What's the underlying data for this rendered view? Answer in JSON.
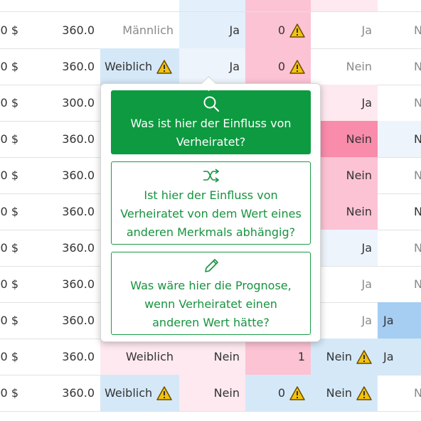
{
  "colors": {
    "accent_green": "#0e9a40",
    "pink_light": "#fde9ef",
    "pink": "#fbc3d4",
    "pink_strong": "#f98bab",
    "blue_light": "#eef4fc",
    "blue": "#d5e8f8",
    "blue_strong": "#a6cdf2",
    "warning": "#f4c20d"
  },
  "table": {
    "rows": [
      {
        "c0": "0 $",
        "c1": "360.0",
        "c2": "Männlich",
        "c3": "Ja",
        "c4": "0",
        "c5": "Ja",
        "c6": "N"
      },
      {
        "c0": "0 $",
        "c1": "360.0",
        "c2": "Weiblich",
        "c3": "Ja",
        "c4": "0",
        "c5": "Nein",
        "c6": "N"
      },
      {
        "c0": "0 $",
        "c1": "300.0",
        "c2": "",
        "c3": "",
        "c4": "",
        "c5": "Ja",
        "c6": "N"
      },
      {
        "c0": "0 $",
        "c1": "360.0",
        "c2": "",
        "c3": "",
        "c4": "",
        "c5": "Nein",
        "c6": "N"
      },
      {
        "c0": "0 $",
        "c1": "360.0",
        "c2": "",
        "c3": "",
        "c4": "",
        "c5": "Nein",
        "c6": "N"
      },
      {
        "c0": "0 $",
        "c1": "360.0",
        "c2": "",
        "c3": "",
        "c4": "",
        "c5": "Nein",
        "c6": "N"
      },
      {
        "c0": "0 $",
        "c1": "360.0",
        "c2": "",
        "c3": "",
        "c4": "",
        "c5": "Ja",
        "c6": "N"
      },
      {
        "c0": "0 $",
        "c1": "360.0",
        "c2": "",
        "c3": "",
        "c4": "",
        "c5": "Ja",
        "c6": "N"
      },
      {
        "c0": "0 $",
        "c1": "360.0",
        "c2": "",
        "c3": "",
        "c4": "",
        "c5": "Ja",
        "c6": "Ja"
      },
      {
        "c0": "0 $",
        "c1": "360.0",
        "c2": "Weiblich",
        "c3": "Nein",
        "c4": "1",
        "c5": "Nein",
        "c6": "Ja"
      },
      {
        "c0": "0 $",
        "c1": "360.0",
        "c2": "Weiblich",
        "c3": "Nein",
        "c4": "0",
        "c5": "Nein",
        "c6": "N"
      }
    ]
  },
  "popover": {
    "option1": {
      "icon": "magnifier-icon",
      "label": "Was ist hier der Einfluss von Verheiratet?"
    },
    "option2": {
      "icon": "shuffle-icon",
      "label": "Ist hier der Einfluss von Verheiratet von dem Wert eines anderen Merkmals abhängig?"
    },
    "option3": {
      "icon": "pencil-icon",
      "label": "Was wäre hier die Prognose, wenn Verheiratet einen anderen Wert hätte?"
    }
  }
}
